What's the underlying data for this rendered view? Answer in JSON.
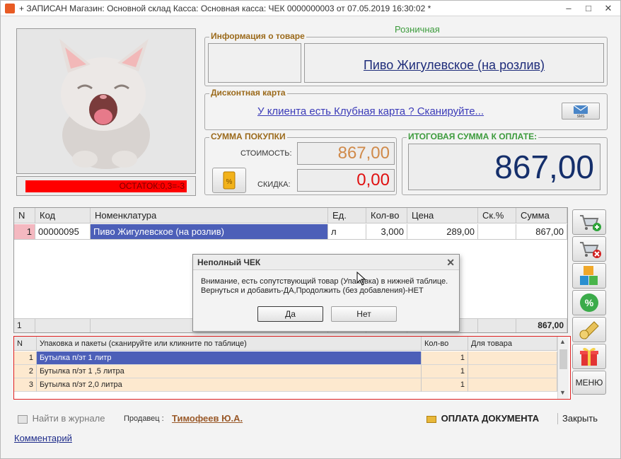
{
  "window": {
    "title": "+ ЗАПИСАН Магазин: Основной склад Касса: Основная касса: ЧЕК 0000000003 от 07.05.2019 16:30:02 *",
    "minimize": "–",
    "maximize": "□",
    "close": "✕"
  },
  "product_info": {
    "legend": "Информация о товаре",
    "price_type": "Розничная",
    "name": "Пиво Жигулевское (на розлив)"
  },
  "stock": {
    "text": "ОСТАТОК:0,3=-3"
  },
  "discount_card": {
    "legend": "Дисконтная карта",
    "link": "У клиента есть Клубная карта ? Сканируйте...",
    "sms_label": "SMS"
  },
  "purchase_sum": {
    "legend": "СУММА ПОКУПКИ",
    "cost_label": "СТОИМОСТЬ:",
    "cost_value": "867,00",
    "discount_label": "СКИДКА:",
    "discount_value": "0,00",
    "colors": {
      "cost": "#d08a4a",
      "discount": "#e01010"
    }
  },
  "total": {
    "legend": "ИТОГОВАЯ СУММА К ОПЛАТЕ:",
    "value": "867,00",
    "legend_color": "#3c9b3c"
  },
  "main_table": {
    "headers": [
      "N",
      "Код",
      "Номенклатура",
      "Ед.",
      "Кол-во",
      "Цена",
      "Ск.%",
      "Сумма"
    ],
    "rows": [
      {
        "n": "1",
        "code": "00000095",
        "name": "Пиво Жигулевское (на розлив)",
        "unit": "л",
        "qty": "3,000",
        "price": "289,00",
        "disc": "",
        "sum": "867,00"
      }
    ],
    "footer": {
      "count": "1",
      "sum": "867,00"
    }
  },
  "pack_table": {
    "headers": [
      "N",
      "Упаковка и пакеты (сканируйте или кликните по таблице)",
      "Кол-во",
      "Для товара"
    ],
    "rows": [
      {
        "n": "1",
        "name": "Бутылка п/эт 1 литр",
        "qty": "1",
        "for": ""
      },
      {
        "n": "2",
        "name": "Бутылка п/эт 1 ,5 литра",
        "qty": "1",
        "for": ""
      },
      {
        "n": "3",
        "name": "Бутылка п/эт 2,0 литра",
        "qty": "1",
        "for": ""
      }
    ]
  },
  "side_buttons": {
    "icons": [
      "cart-add-icon",
      "cart-remove-icon",
      "blocks-icon",
      "percent-icon",
      "tape-measure-icon",
      "gift-icon"
    ],
    "menu": "МЕНЮ"
  },
  "dialog": {
    "title": "Неполный ЧЕК",
    "line1": "Внимание, есть сопутствующий товар (Упаковка) в нижней таблице.",
    "line2": "Вернуться и добавить-ДА,Продолжить (без добавления)-НЕТ",
    "yes": "Да",
    "no": "Нет",
    "close": "✕"
  },
  "bottom_bar": {
    "journal": "Найти в журнале",
    "seller_label": "Продавец :",
    "seller_name": "Тимофеев Ю.А.",
    "pay": "ОПЛАТА ДОКУМЕНТА",
    "close": "Закрыть",
    "comment": "Комментарий"
  }
}
